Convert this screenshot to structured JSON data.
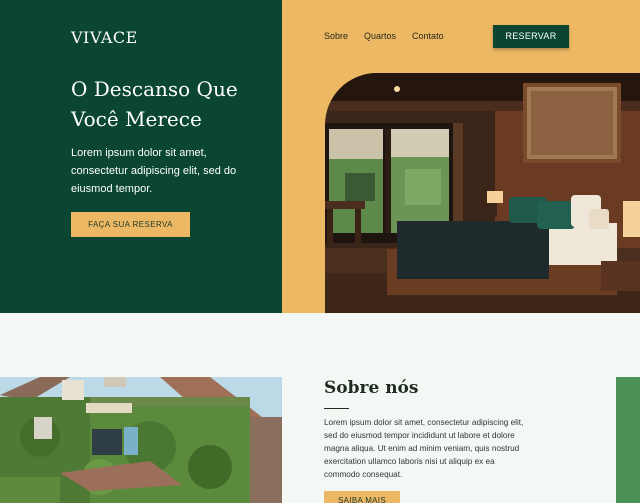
{
  "brand": {
    "logo": "VIVACE"
  },
  "nav": {
    "items": [
      "Sobre",
      "Quartos",
      "Contato"
    ],
    "reserve_label": "RESERVAR"
  },
  "hero": {
    "title": "O Descanso Que Você Merece",
    "text": "Lorem ipsum dolor sit amet, consectetur adipiscing elit, sed do eiusmod tempor.",
    "cta_label": "FAÇA SUA RESERVA"
  },
  "about": {
    "title": "Sobre nós",
    "text": "Lorem ipsum dolor sit amet, consectetur adipiscing elit, sed do eiusmod tempor incididunt ut labore et dolore magna aliqua. Ut enim ad minim veniam, quis nostrud exercitation ullamco laboris nisi ut aliquip ex ea commodo consequat.",
    "cta_label": "SAIBA MAIS"
  },
  "colors": {
    "dark_green": "#0b4632",
    "gold": "#ecb863",
    "light_bg": "#f4f8f4",
    "accent_green": "#4b9158"
  }
}
